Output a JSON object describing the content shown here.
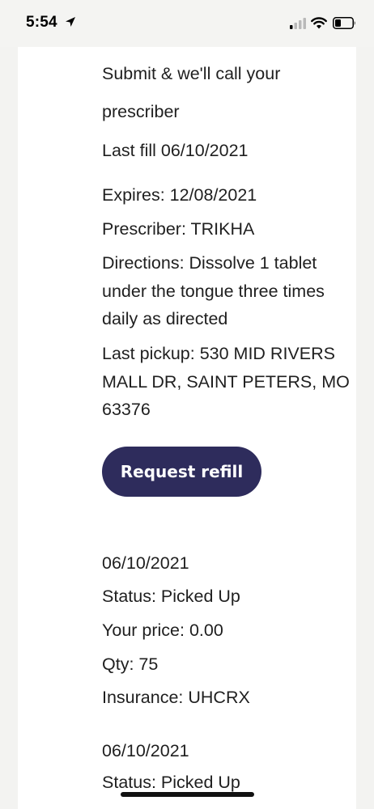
{
  "status_bar": {
    "time": "5:54",
    "icons": [
      "location-arrow-icon",
      "cellular-signal-icon",
      "wifi-icon",
      "battery-icon"
    ]
  },
  "prescription": {
    "submit_line_1": "Submit & we'll call your",
    "submit_line_2": "prescriber",
    "last_fill": "Last fill 06/10/2021",
    "expires": "Expires: 12/08/2021",
    "prescriber": "Prescriber: TRIKHA",
    "directions": "Directions: Dissolve 1 tablet under the tongue three times daily as directed",
    "last_pickup": "Last pickup: 530 MID RIVERS MALL DR, SAINT PETERS, MO 63376",
    "request_refill_label": "Request refill"
  },
  "fill_history": [
    {
      "date": "06/10/2021",
      "status": "Status: Picked Up",
      "price": "Your price: 0.00",
      "qty": "Qty: 75",
      "insurance": "Insurance: UHCRX"
    },
    {
      "date": "06/10/2021",
      "status": "Status: Picked Up"
    }
  ],
  "colors": {
    "button_bg": "#2e2c5c",
    "page_bg": "#f3f3f1",
    "card_bg": "#ffffff"
  }
}
